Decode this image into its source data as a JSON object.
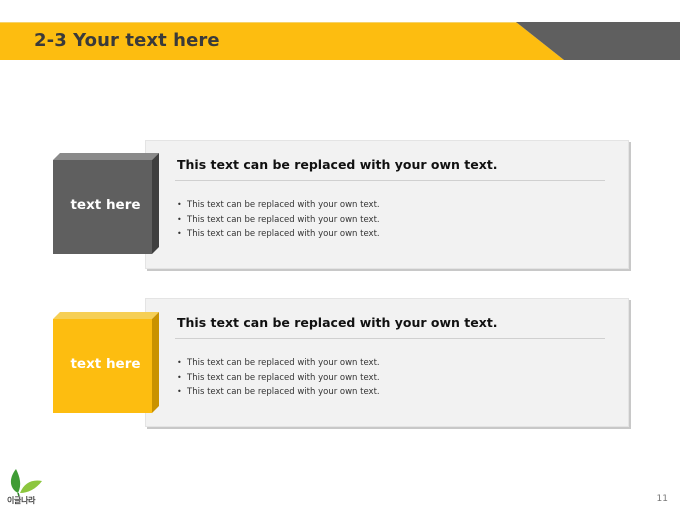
{
  "slide": {
    "title": "2-3 Your text here",
    "page_number": "11"
  },
  "colors": {
    "accent_yellow": "#fdbd10",
    "accent_gray": "#5f5f5f",
    "panel_bg": "#f2f2f2"
  },
  "logo": {
    "icon": "leaf-sprout-icon",
    "text": "이글나라"
  },
  "items": [
    {
      "box_label": "text here",
      "box_color": "gray",
      "heading": "This text can be replaced with your own text.",
      "bullets": [
        "This text can be replaced with your own text.",
        "This text can be replaced with your own text.",
        "This text can be replaced with your own text."
      ]
    },
    {
      "box_label": "text here",
      "box_color": "yellow",
      "heading": "This text can be replaced with your own text.",
      "bullets": [
        "This text can be replaced with your own text.",
        "This text can be replaced with your own text.",
        "This text can be replaced with your own text."
      ]
    }
  ]
}
